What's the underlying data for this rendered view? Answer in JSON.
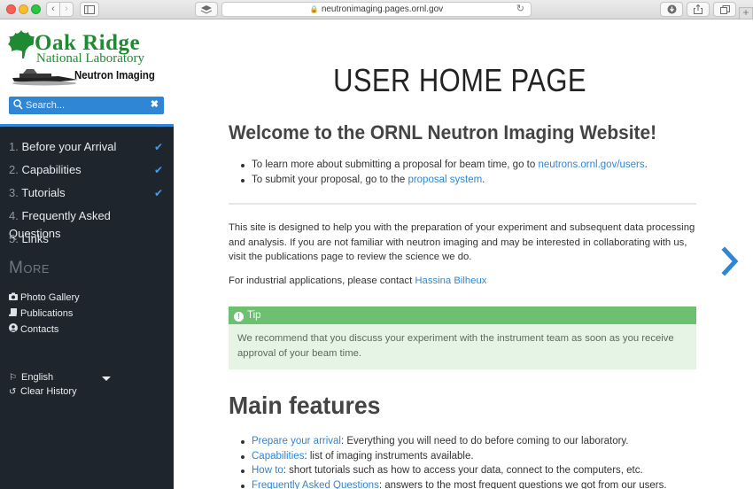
{
  "browser": {
    "url": "neutronimaging.pages.ornl.gov"
  },
  "brand": {
    "line1": "Oak Ridge",
    "line2": "National Laboratory",
    "line3": "Neutron Imaging"
  },
  "search": {
    "placeholder": "Search..."
  },
  "nav": {
    "items": [
      {
        "num": "1.",
        "label": "Before your Arrival",
        "checked": true
      },
      {
        "num": "2.",
        "label": "Capabilities",
        "checked": true
      },
      {
        "num": "3.",
        "label": "Tutorials",
        "checked": true
      },
      {
        "num": "4.",
        "label": "Frequently Asked Questions",
        "checked": false
      },
      {
        "num": "5.",
        "label": "Links",
        "checked": false
      }
    ],
    "more_title": "More",
    "more_items": [
      {
        "icon": "camera-icon",
        "label": "Photo Gallery"
      },
      {
        "icon": "book-icon",
        "label": "Publications"
      },
      {
        "icon": "user-icon",
        "label": "Contacts"
      }
    ],
    "language": "English",
    "clear_history": "Clear History"
  },
  "main": {
    "title": "USER HOME PAGE",
    "welcome": "Welcome to the ORNL Neutron Imaging Website!",
    "bullets": [
      {
        "pre": "To learn more about submitting a proposal for beam time, go to ",
        "link": "neutrons.ornl.gov/users",
        "post": "."
      },
      {
        "pre": "To submit your proposal, go to the ",
        "link": "proposal system",
        "post": "."
      }
    ],
    "intro": "This site is designed to help you with the preparation of your experiment and subsequent data processing and analysis. If you are not familiar with neutron imaging and may be interested in collaborating with us, visit the publications page to review the science we do.",
    "industrial_pre": "For industrial applications, please contact ",
    "industrial_link": "Hassina Bilheux",
    "tip_title": "Tip",
    "tip_text": "We recommend that you discuss your experiment with the instrument team as soon as you receive approval of your beam time.",
    "features_title": "Main features",
    "features": [
      {
        "link": "Prepare your arrival",
        "text": ": Everything you will need to do before coming to our laboratory."
      },
      {
        "link": "Capabilities",
        "text": ": list of imaging instruments available."
      },
      {
        "link": "How to",
        "text": ": short tutorials such as how to access your data, connect to the computers, etc."
      },
      {
        "link": "Frequently Asked Questions",
        "text": ": answers to the most frequent questions we got from our users."
      }
    ]
  },
  "colors": {
    "accent": "#2f86d4",
    "sidebar_bg": "#1e252d",
    "tip_header": "#6cc06f",
    "tip_body": "#e6f4e6",
    "brand_green": "#1f8a32"
  }
}
